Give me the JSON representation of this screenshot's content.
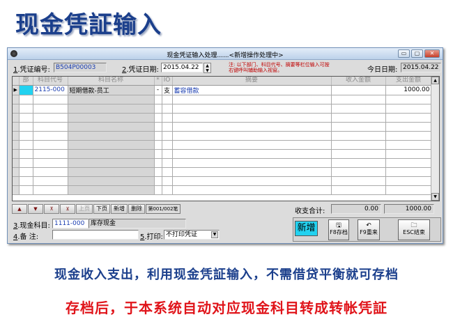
{
  "slide": {
    "title": "现金凭証输入",
    "caption1": "现金收入支出，利用现金凭証输入，不需借贷平衡就可存档",
    "caption2": "存档后，于本系统自动对应现金科目转成转帐凭証"
  },
  "window": {
    "title": "现金凭证输入处理......<新增操作处理中>",
    "min_glyph": "▭",
    "max_glyph": "▢",
    "close_glyph": "✕"
  },
  "header": {
    "voucher_no_label_num": "1",
    "voucher_no_label": ".凭证编号:",
    "voucher_no": "B504P00003",
    "voucher_date_label_num": "2",
    "voucher_date_label": ".凭证日期:",
    "voucher_date": "2015.04.22",
    "note": "注: 以下部门、科目代号、摘要等栏位输入可按右键呼叫辅助输入视窗。",
    "today_label": "今日日期:",
    "today": "2015.04.22"
  },
  "grid": {
    "columns": [
      "部",
      "科目代号",
      "科目名称",
      "*",
      "IO",
      "摘要",
      "收入金额",
      "支出金额"
    ],
    "rows": [
      {
        "dept": "",
        "code": "2115-000",
        "name": "短期借款-员工",
        "star": "-",
        "io": "支",
        "summary": "蓄容借款",
        "income": "",
        "expense": "1000.00"
      }
    ],
    "empty_rows": 11
  },
  "nav": {
    "first": "▲",
    "down": "▼",
    "top": "⊼",
    "bottom": "⊻",
    "prev": "上页",
    "next": "下页",
    "add": "新增",
    "delete": "删除",
    "record": "第001/002笔"
  },
  "totals": {
    "label": "收支合计:",
    "income": "0.00",
    "expense": "1000.00"
  },
  "footer": {
    "cash_account_label_num": "3",
    "cash_account_label": ".现金科目:",
    "cash_account_code": "1111-000",
    "cash_account_name": "库存现金",
    "remark_label_num": "4",
    "remark_label": ".备    注:",
    "remark": "",
    "print_label_num": "5",
    "print_label": ".打印:",
    "print_option": "不打印凭证"
  },
  "actions": {
    "mode": "新增",
    "save": "F8存档",
    "redo": "F9重来",
    "exit": "ESC结束"
  }
}
